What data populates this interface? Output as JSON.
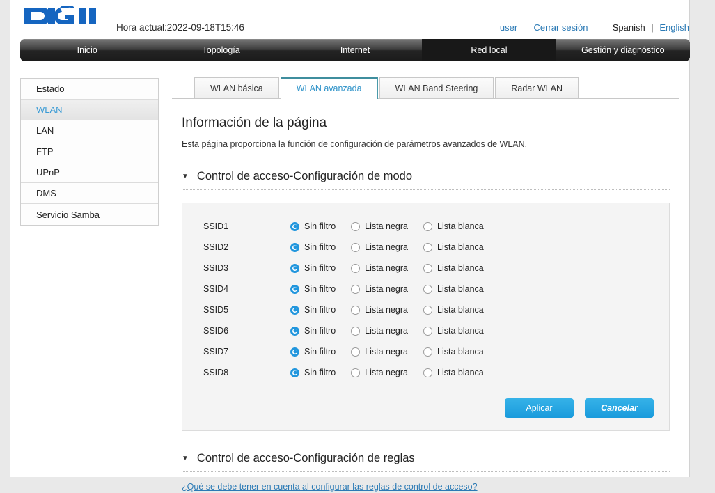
{
  "header": {
    "logo_text": "DIGI",
    "time_label": "Hora actual:2022-09-18T15:46",
    "user_link": "user",
    "logout_link": "Cerrar sesión",
    "lang_active": "Spanish",
    "lang_separator": "|",
    "lang_other": "English"
  },
  "nav": {
    "items": [
      {
        "label": "Inicio",
        "active": false
      },
      {
        "label": "Topología",
        "active": false
      },
      {
        "label": "Internet",
        "active": false
      },
      {
        "label": "Red local",
        "active": true
      },
      {
        "label": "Gestión y diagnóstico",
        "active": false
      }
    ]
  },
  "sidebar": {
    "items": [
      {
        "label": "Estado",
        "active": false
      },
      {
        "label": "WLAN",
        "active": true
      },
      {
        "label": "LAN",
        "active": false
      },
      {
        "label": "FTP",
        "active": false
      },
      {
        "label": "UPnP",
        "active": false
      },
      {
        "label": "DMS",
        "active": false
      },
      {
        "label": "Servicio Samba",
        "active": false
      }
    ]
  },
  "tabs": [
    {
      "label": "WLAN básica",
      "active": false
    },
    {
      "label": "WLAN avanzada",
      "active": true
    },
    {
      "label": "WLAN Band Steering",
      "active": false
    },
    {
      "label": "Radar WLAN",
      "active": false
    }
  ],
  "page": {
    "title": "Información de la página",
    "description": "Esta página proporciona la función de configuración de parámetros avanzados de WLAN."
  },
  "section_mode": {
    "caret": "▼",
    "title": "Control de acceso-Configuración de modo",
    "options": [
      "Sin filtro",
      "Lista negra",
      "Lista blanca"
    ],
    "rows": [
      {
        "ssid": "SSID1",
        "selected": 0
      },
      {
        "ssid": "SSID2",
        "selected": 0
      },
      {
        "ssid": "SSID3",
        "selected": 0
      },
      {
        "ssid": "SSID4",
        "selected": 0
      },
      {
        "ssid": "SSID5",
        "selected": 0
      },
      {
        "ssid": "SSID6",
        "selected": 0
      },
      {
        "ssid": "SSID7",
        "selected": 0
      },
      {
        "ssid": "SSID8",
        "selected": 0
      }
    ],
    "apply_label": "Aplicar",
    "cancel_label": "Cancelar"
  },
  "section_rules": {
    "caret": "▼",
    "title": "Control de acceso-Configuración de reglas",
    "help_link": "¿Qué se debe tener en cuenta al configurar las reglas de control de acceso?"
  },
  "colors": {
    "accent_blue": "#2196dd",
    "link_blue": "#2b7ab5",
    "tab_active": "#2f93c9",
    "logo_blue": "#1565c0"
  }
}
